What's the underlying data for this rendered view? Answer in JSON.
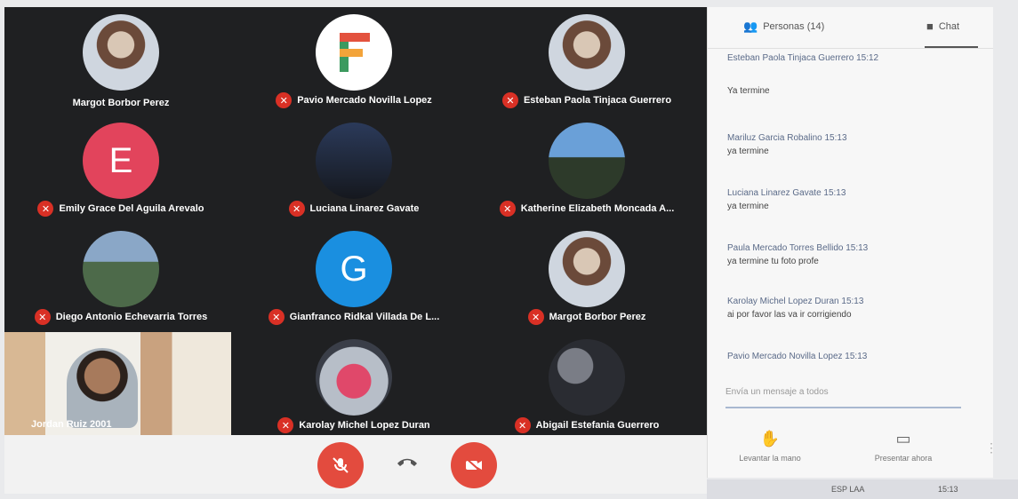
{
  "participants": [
    {
      "name": "Margot Borbor Perez",
      "avatar": "photo",
      "muted": false
    },
    {
      "name": "Pavio Mercado Novilla Lopez",
      "avatar": "letter",
      "letter": "F",
      "muted": true
    },
    {
      "name": "Esteban Paola Tinjaca Guerrero",
      "avatar": "photo",
      "muted": true
    },
    {
      "name": "Emily Grace Del Aguila Arevalo",
      "avatar": "letter",
      "letter": "E",
      "color": "#e2445c",
      "muted": true
    },
    {
      "name": "Luciana Linarez Gavate",
      "avatar": "photo-dark",
      "muted": true
    },
    {
      "name": "Katherine Elizabeth Moncada A...",
      "avatar": "photo-sky",
      "muted": true
    },
    {
      "name": "Diego Antonio Echevarria Torres",
      "avatar": "photo-bldg",
      "muted": true
    },
    {
      "name": "Gianfranco Ridkal Villada De L...",
      "avatar": "letter",
      "letter": "G",
      "color": "#1a8fe0",
      "muted": true
    },
    {
      "name": "Margot Borbor Perez",
      "avatar": "photo",
      "muted": true
    },
    {
      "name": "Karolay Michel Lopez Duran",
      "avatar": "photo-helmet",
      "muted": true
    },
    {
      "name": "Abigail Estefania Guerrero",
      "avatar": "photo-moon",
      "muted": true
    }
  ],
  "self_video": {
    "name": "Jordan Ruiz 2001"
  },
  "controls": {
    "mic_icon": "mic-off-icon",
    "hangup_icon": "phone-hangup-icon",
    "camera_icon": "camera-off-icon"
  },
  "panel": {
    "tab_people": "Personas (14)",
    "tab_chat": "Chat",
    "messages": [
      {
        "sender": "Esteban Paola Tinjaca Guerrero 15:12",
        "text": "Ya termine"
      },
      {
        "sender": "Mariluz Garcia Robalino 15:13",
        "text": "ya termine"
      },
      {
        "sender": "Luciana Linarez Gavate 15:13",
        "text": "ya termine"
      },
      {
        "sender": "Paula Mercado Torres Bellido 15:13",
        "text": "ya termine tu foto profe"
      },
      {
        "sender": "Karolay Michel Lopez Duran 15:13",
        "text": "ai por favor las va ir corrigiendo"
      },
      {
        "sender": "Pavio Mercado Novilla Lopez 15:13",
        "text": ""
      }
    ],
    "input_placeholder": "Envía un mensaje a todos",
    "raise_hand_label": "Levantar la mano",
    "present_label": "Presentar ahora"
  },
  "taskbar": {
    "lang": "ESP LAA",
    "time": "15:13"
  },
  "colors": {
    "mute_red": "#d93025",
    "control_red": "#e34b3e",
    "stage_bg": "#1f2022"
  }
}
